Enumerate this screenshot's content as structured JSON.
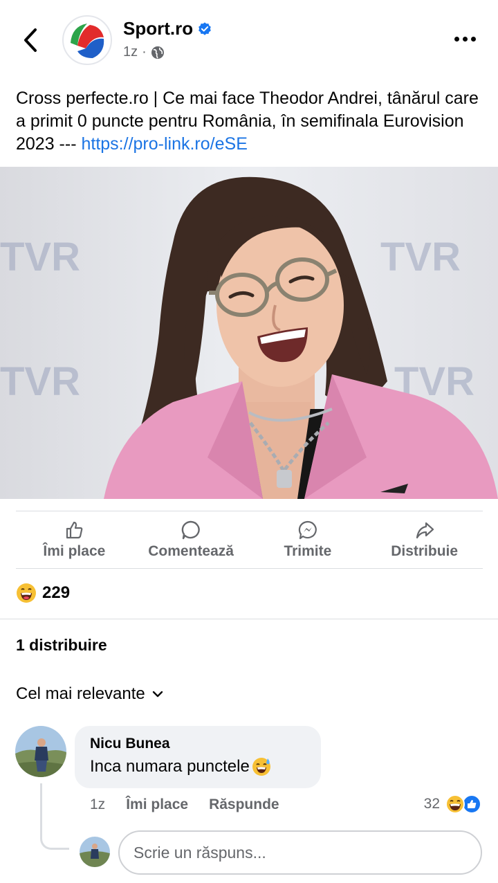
{
  "header": {
    "page_name": "Sport.ro",
    "time": "1z",
    "privacy_icon": "globe-icon",
    "verified_icon": "verified-badge-icon"
  },
  "post": {
    "text": "Cross perfecte.ro | Ce mai face Theodor Andrei, tânărul care a primit 0 puncte pentru România, în semifinala Eurovision 2023 --- ",
    "link": "https://pro-link.ro/eSE"
  },
  "photo": {
    "backdrop_logo": "TVR"
  },
  "actions": {
    "like": "Îmi place",
    "comment": "Comentează",
    "send": "Trimite",
    "share": "Distribuie"
  },
  "reactions": {
    "count": "229",
    "icon": "laughing-emoji-icon"
  },
  "shares_label": "1 distribuire",
  "sort_label": "Cel mai relevante",
  "comment": {
    "author": "Nicu Bunea",
    "text": "Inca numara punctele",
    "time": "1z",
    "like": "Îmi place",
    "reply": "Răspunde",
    "reaction_count": "32"
  },
  "reply": {
    "placeholder": "Scrie un răspuns..."
  },
  "colors": {
    "link": "#1b74e4",
    "secondary_text": "#65676b",
    "bubble": "#f0f2f5",
    "jacket": "#e89ac0"
  }
}
